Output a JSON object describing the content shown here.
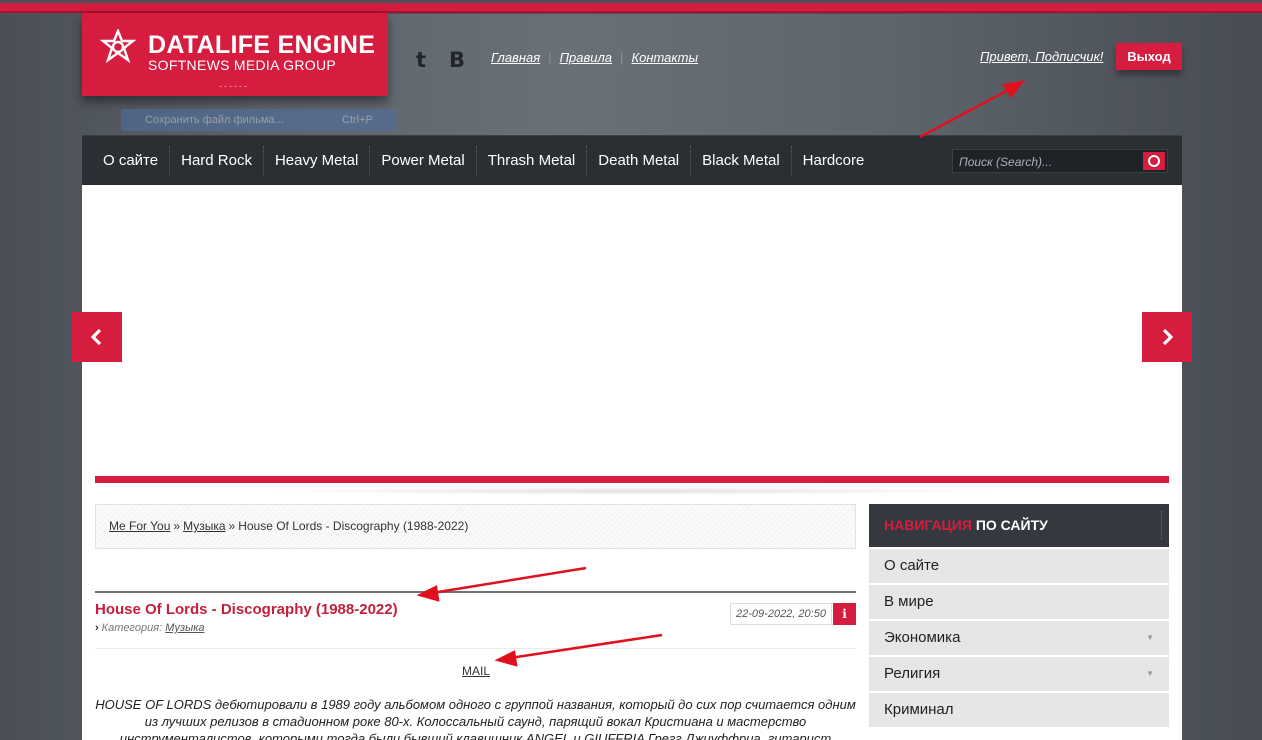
{
  "logo": {
    "title": "DATALIFE ENGINE",
    "subtitle": "SOFTNEWS MEDIA GROUP",
    "dots": "------"
  },
  "ghost_tooltip": {
    "label": "Сохранить файл фильма...",
    "shortcut": "Ctrl+P"
  },
  "social": {
    "twitter": "t",
    "vk": "B"
  },
  "top_links": [
    "Главная",
    "Правила",
    "Контакты"
  ],
  "user": {
    "greeting": "Привет, Подписчик!",
    "logout_label": "Выход"
  },
  "nav": [
    "О сайте",
    "Hard Rock",
    "Heavy Metal",
    "Power Metal",
    "Thrash Metal",
    "Death Metal",
    "Black Metal",
    "Hardcore"
  ],
  "search": {
    "placeholder": "Поиск (Search)..."
  },
  "breadcrumb": {
    "items": [
      "Me For You",
      "Музыка",
      "House Of Lords - Discography (1988-2022)"
    ],
    "separator": "»"
  },
  "article": {
    "title": "House Of Lords - Discography (1988-2022)",
    "category_label": "Категория:",
    "category": "Музыка",
    "date": "22-09-2022, 20:50",
    "info": "i",
    "mail": "MAIL",
    "text": "HOUSE OF LORDS дебютировали в 1989 году альбомом одного с группой названия, который до сих пор считается одним из лучших релизов в стадионном роке 80-х. Колоссальный саунд, парящий вокал Кристиана и мастерство инструменталистов, которыми тогда были бывший клавишник ANGEL и GIUFFRIA Грегг Джиуффриа, гитарист"
  },
  "sidebar": {
    "title_red": "НАВИГАЦИЯ",
    "title_rest": "ПО САЙТУ",
    "items": [
      {
        "label": "О сайте",
        "submenu": false
      },
      {
        "label": "В мире",
        "submenu": false
      },
      {
        "label": "Экономика",
        "submenu": true
      },
      {
        "label": "Религия",
        "submenu": true
      },
      {
        "label": "Криминал",
        "submenu": false
      }
    ]
  },
  "colors": {
    "accent": "#d61c3f",
    "nav_bg": "#2b2f34",
    "annotation": "#e0101e"
  }
}
